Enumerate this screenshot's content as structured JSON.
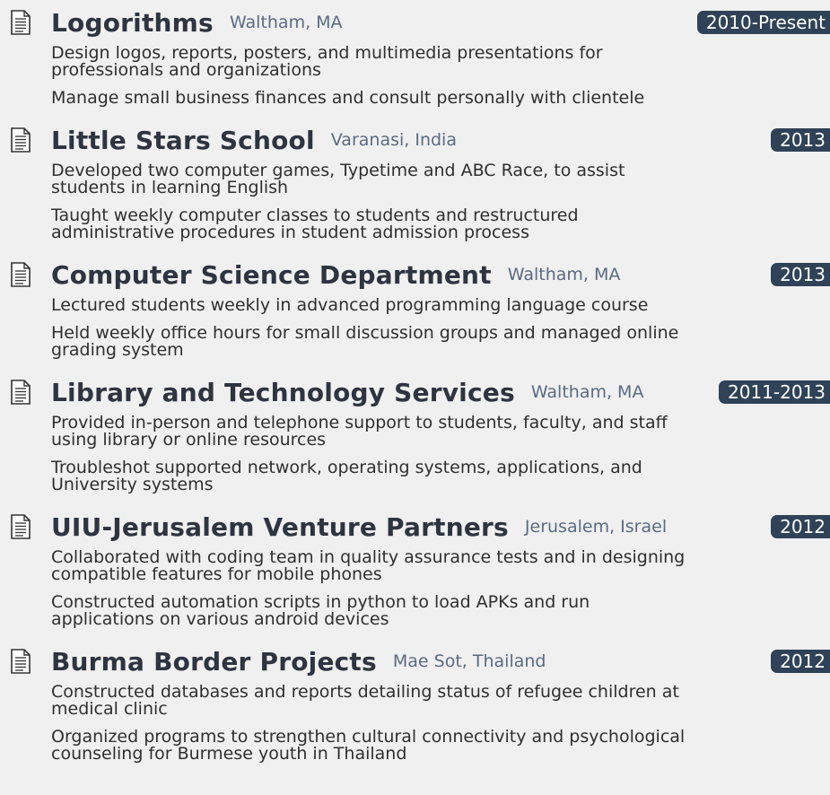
{
  "entries": [
    {
      "organization": "Logorithms",
      "location": "Waltham, MA",
      "date": "2010-Present",
      "items": [
        "Design logos, reports, posters, and multimedia presentations for professionals and organizations",
        "Manage small business finances and consult personally with clientele"
      ]
    },
    {
      "organization": "Little Stars School",
      "location": "Varanasi, India",
      "date": "2013",
      "items": [
        "Developed two computer games, Typetime and ABC Race, to assist students in learning English",
        "Taught weekly computer classes to students and restructured administrative procedures in student admission process"
      ]
    },
    {
      "organization": "Computer Science Department",
      "location": "Waltham, MA",
      "date": "2013",
      "items": [
        "Lectured students weekly in advanced programming language course",
        "Held weekly office hours for small discussion groups and managed online grading system"
      ]
    },
    {
      "organization": "Library and Technology Services",
      "location": "Waltham, MA",
      "date": "2011-2013",
      "items": [
        "Provided in-person and telephone support to students, faculty, and staff using library or online resources",
        "Troubleshot supported network, operating systems, applications, and University systems"
      ]
    },
    {
      "organization": "UIU-Jerusalem Venture Partners",
      "location": "Jerusalem, Israel",
      "date": "2012",
      "items": [
        "Collaborated with coding team in quality assurance tests and in designing compatible features for mobile phones",
        "Constructed automation scripts in python to load APKs and run applications on various android devices"
      ]
    },
    {
      "organization": "Burma Border Projects",
      "location": "Mae Sot, Thailand",
      "date": "2012",
      "items": [
        "Constructed databases and reports detailing status of refugee children at medical clinic",
        "Organized programs to strengthen cultural connectivity and psychological counseling for Burmese youth in Thailand"
      ]
    }
  ],
  "icon": "document-icon"
}
